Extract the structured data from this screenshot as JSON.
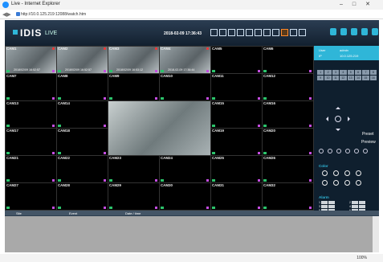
{
  "browser": {
    "title": "Live - Internet Explorer",
    "url": "http://10.0.125.219:12088/watch.htm",
    "zoom": "100%"
  },
  "app": {
    "brand": "IDIS",
    "mode": "LIVE",
    "datetime": "2018-02-09 17:36:43",
    "accent": "#2fb6d8",
    "layout_selected_index": 8
  },
  "cameras": [
    {
      "name": "CAM1",
      "video": true,
      "timestamp": "2018/02/09 16:52:57"
    },
    {
      "name": "CAM2",
      "video": true,
      "timestamp": "2018/02/09 16:52:57"
    },
    {
      "name": "CAM3",
      "video": true,
      "timestamp": "2018/02/09 16:53:12"
    },
    {
      "name": "CAM4",
      "video": true,
      "timestamp": "2018-02-09 17:36:44"
    },
    {
      "name": "CAM5",
      "video": false
    },
    {
      "name": "CAM6",
      "video": false
    },
    {
      "name": "CAM7",
      "video": false
    },
    {
      "name": "CAM8",
      "video": false
    },
    {
      "name": "CAM9",
      "video": false
    },
    {
      "name": "CAM10",
      "video": false
    },
    {
      "name": "CAM11",
      "video": false
    },
    {
      "name": "CAM12",
      "video": false
    },
    {
      "name": "CAM13",
      "video": false
    },
    {
      "name": "CAM14",
      "video": false
    },
    {
      "name": "CAM15",
      "video": false
    },
    {
      "name": "CAM16",
      "video": false
    },
    {
      "name": "CAM17",
      "video": false
    },
    {
      "name": "CAM18",
      "video": false
    },
    {
      "name": "CAM19",
      "video": false
    },
    {
      "name": "CAM20",
      "video": false
    },
    {
      "name": "CAM21",
      "video": false
    },
    {
      "name": "CAM22",
      "video": false
    },
    {
      "name": "CAM23",
      "video": false
    },
    {
      "name": "CAM24",
      "video": false
    },
    {
      "name": "CAM25",
      "video": false
    },
    {
      "name": "CAM26",
      "video": false
    },
    {
      "name": "CAM27",
      "video": false
    },
    {
      "name": "CAM28",
      "video": false
    },
    {
      "name": "CAM29",
      "video": false
    },
    {
      "name": "CAM30",
      "video": false
    },
    {
      "name": "CAM31",
      "video": false
    },
    {
      "name": "CAM32",
      "video": false
    }
  ],
  "side": {
    "user_label": "User",
    "user_value": "admin",
    "ip_label": "IP",
    "ip_value": "10.0.125.219",
    "channels": [
      "1",
      "2",
      "3",
      "4",
      "5",
      "6",
      "7",
      "8",
      "9",
      "10",
      "11",
      "12",
      "13",
      "14",
      "15",
      "16"
    ],
    "preset": "Preset",
    "preview": "Preview",
    "color_title": "Color",
    "alarm_title": "Alarm",
    "alarms": [
      "1",
      "2",
      "3",
      "4",
      "5",
      "6",
      "7",
      "8"
    ],
    "on": "ON",
    "off": "OFF"
  },
  "events": {
    "col_site": "Site",
    "col_event": "Event",
    "col_datetime": "Date / time"
  }
}
